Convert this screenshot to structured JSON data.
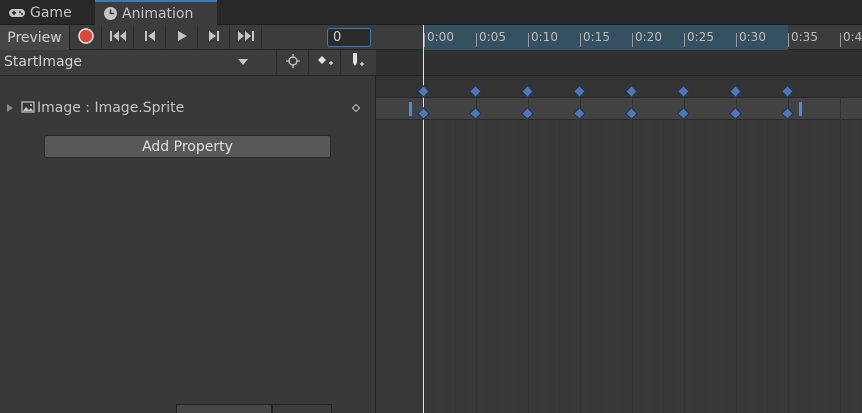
{
  "tabs": [
    {
      "label": "Game",
      "icon": "gamepad-icon"
    },
    {
      "label": "Animation",
      "icon": "clock-icon"
    }
  ],
  "toolbar": {
    "preview_label": "Preview",
    "frame_value": "0"
  },
  "clip": {
    "name": "StartImage"
  },
  "property": {
    "label": "Image : Image.Sprite"
  },
  "add_property_label": "Add Property",
  "timeline": {
    "ticks": [
      "0:00",
      "0:05",
      "0:10",
      "0:15",
      "0:20",
      "0:25",
      "0:30",
      "0:35",
      "0:4"
    ],
    "keyframes": [
      "0:00",
      "0:05",
      "0:10",
      "0:15",
      "0:20",
      "0:25",
      "0:30",
      "0:35"
    ]
  },
  "colors": {
    "record": "#e0453a",
    "keyframe": "#4f77b8",
    "accent": "#3a79bb"
  }
}
